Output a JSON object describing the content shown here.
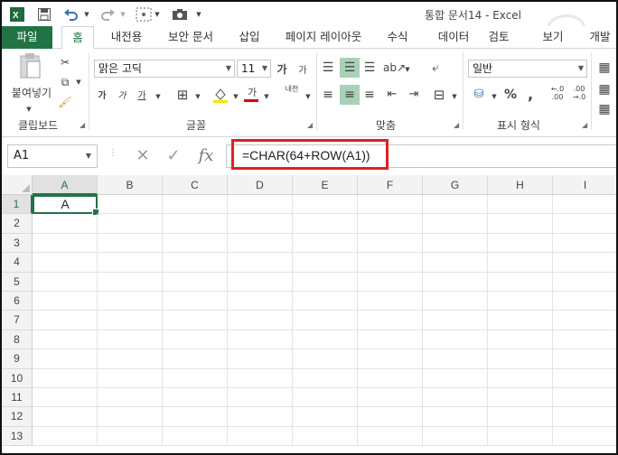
{
  "window": {
    "title": "통합 문서14 - Excel"
  },
  "qat": {
    "excel_icon": "excel-logo-icon",
    "save_icon": "save-icon",
    "undo_icon": "undo-icon",
    "redo_icon": "redo-icon",
    "touch_icon": "touch-mode-icon",
    "camera_icon": "camera-icon"
  },
  "tabs": [
    "파일",
    "홈",
    "내전용",
    "보안 문서",
    "삽입",
    "페이지 레이아웃",
    "수식",
    "데이터",
    "검토",
    "보기",
    "개발"
  ],
  "ribbon": {
    "clipboard": {
      "paste_label": "붙여넣기",
      "group_label": "클립보드"
    },
    "font": {
      "font_name": "맑은 고딕",
      "font_size": "11",
      "bold": "가",
      "italic": "가",
      "underline": "가",
      "grow": "가",
      "shrink": "가",
      "color_letter": "가",
      "phonetic": "내천",
      "group_label": "글꼴"
    },
    "alignment": {
      "group_label": "맞춤"
    },
    "number": {
      "format": "일반",
      "percent": "%",
      "comma": ",",
      "group_label": "표시 형식"
    }
  },
  "formula_bar": {
    "name_box": "A1",
    "cancel": "✕",
    "enter": "✓",
    "fx": "fx",
    "formula": "=CHAR(64+ROW(A1))"
  },
  "sheet": {
    "columns": [
      "A",
      "B",
      "C",
      "D",
      "E",
      "F",
      "G",
      "H",
      "I"
    ],
    "rows": [
      "1",
      "2",
      "3",
      "4",
      "5",
      "6",
      "7",
      "8",
      "9",
      "10",
      "11",
      "12",
      "13"
    ],
    "active_cell": "A1",
    "a1_value": "A"
  },
  "colors": {
    "accent": "#217346",
    "highlight": "#e02020"
  }
}
